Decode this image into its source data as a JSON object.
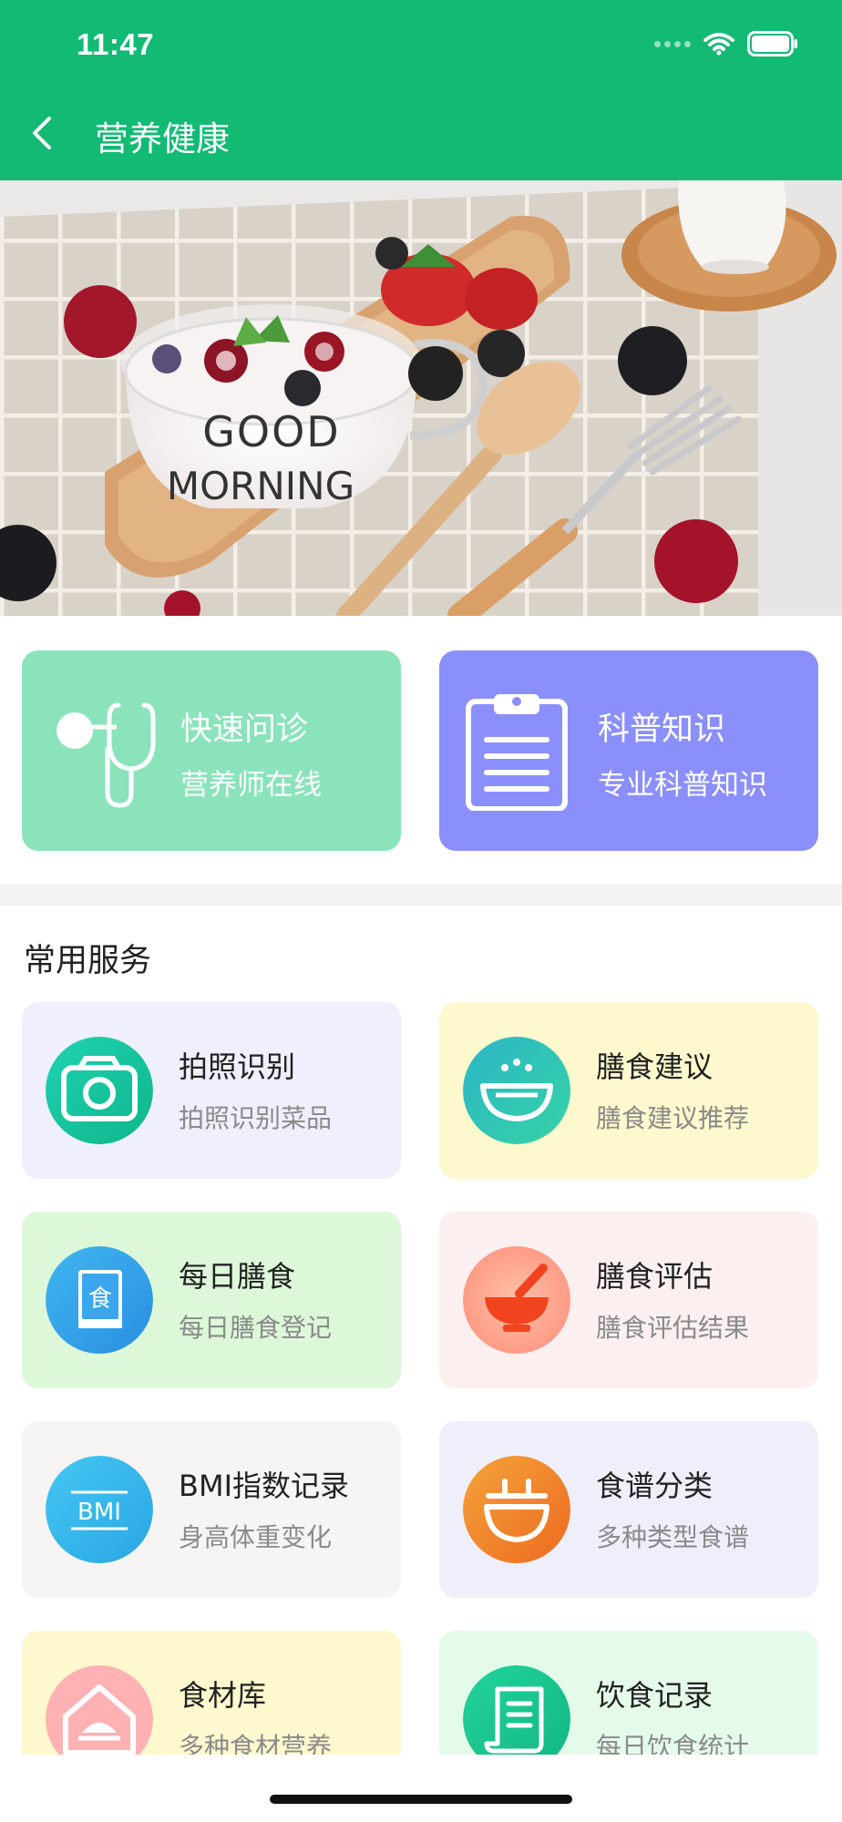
{
  "status_bar": {
    "time": "11:47"
  },
  "nav": {
    "title": "营养健康"
  },
  "features": [
    {
      "title": "快速问诊",
      "subtitle": "营养师在线",
      "icon": "stethoscope-icon",
      "color": "#8be3bb"
    },
    {
      "title": "科普知识",
      "subtitle": "专业科普知识",
      "icon": "clipboard-icon",
      "color": "#8b8ffb"
    }
  ],
  "section": {
    "title": "常用服务"
  },
  "services": [
    {
      "title": "拍照识别",
      "subtitle": "拍照识别菜品",
      "icon": "camera-icon",
      "bg": "#efeffd"
    },
    {
      "title": "膳食建议",
      "subtitle": "膳食建议推荐",
      "icon": "bowl-icon",
      "bg": "#fdf8cd"
    },
    {
      "title": "每日膳食",
      "subtitle": "每日膳食登记",
      "icon": "food-book-icon",
      "bg": "#dcf8d8",
      "icon_text": "食"
    },
    {
      "title": "膳食评估",
      "subtitle": "膳食评估结果",
      "icon": "mortar-icon",
      "bg": "#fcefef"
    },
    {
      "title": "BMI指数记录",
      "subtitle": "身高体重变化",
      "icon": "bmi-icon",
      "bg": "#f7f5f3",
      "icon_text": "BMI"
    },
    {
      "title": "食谱分类",
      "subtitle": "多种类型食谱",
      "icon": "recipe-pot-icon",
      "bg": "#efeffc"
    },
    {
      "title": "食材库",
      "subtitle": "多种食材营养",
      "icon": "pantry-house-icon",
      "bg": "#fdf8cd"
    },
    {
      "title": "饮食记录",
      "subtitle": "每日饮食统计",
      "icon": "scroll-icon",
      "bg": "#e5fbe9"
    }
  ],
  "banner": {
    "caption_line1": "GOOD",
    "caption_line2": "MORNING"
  }
}
